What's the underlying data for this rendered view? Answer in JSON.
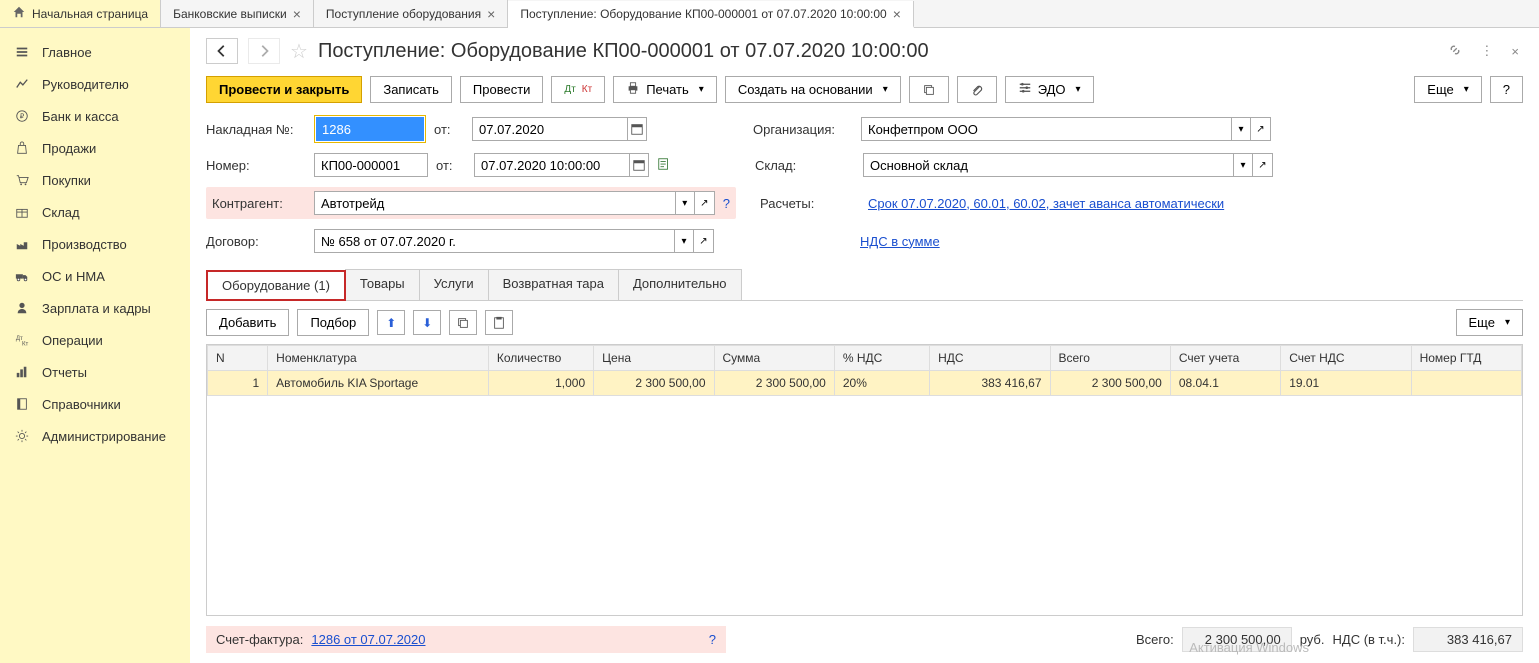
{
  "tabs": {
    "home": "Начальная страница",
    "t1": "Банковские выписки",
    "t2": "Поступление оборудования",
    "t3": "Поступление: Оборудование КП00-000001 от 07.07.2020 10:00:00"
  },
  "sidebar": [
    {
      "icon": "menu",
      "label": "Главное"
    },
    {
      "icon": "chart",
      "label": "Руководителю"
    },
    {
      "icon": "ruble",
      "label": "Банк и касса"
    },
    {
      "icon": "bag",
      "label": "Продажи"
    },
    {
      "icon": "cart",
      "label": "Покупки"
    },
    {
      "icon": "box",
      "label": "Склад"
    },
    {
      "icon": "factory",
      "label": "Производство"
    },
    {
      "icon": "truck",
      "label": "ОС и НМА"
    },
    {
      "icon": "person",
      "label": "Зарплата и кадры"
    },
    {
      "icon": "ops",
      "label": "Операции"
    },
    {
      "icon": "bars",
      "label": "Отчеты"
    },
    {
      "icon": "book",
      "label": "Справочники"
    },
    {
      "icon": "gear",
      "label": "Администрирование"
    }
  ],
  "page_title": "Поступление: Оборудование КП00-000001 от 07.07.2020 10:00:00",
  "toolbar": {
    "post_close": "Провести и закрыть",
    "save": "Записать",
    "post": "Провести",
    "print": "Печать",
    "create_based": "Создать на основании",
    "edo": "ЭДО",
    "more": "Еще"
  },
  "form": {
    "invoice_label": "Накладная  №:",
    "invoice_no": "1286",
    "from_label": "от:",
    "invoice_date": "07.07.2020",
    "number_label": "Номер:",
    "number": "КП00-000001",
    "doc_date": "07.07.2020 10:00:00",
    "org_label": "Организация:",
    "org": "Конфетпром ООО",
    "warehouse_label": "Склад:",
    "warehouse": "Основной склад",
    "counterparty_label": "Контрагент:",
    "counterparty": "Автотрейд",
    "calc_label": "Расчеты:",
    "calc_link": "Срок 07.07.2020, 60.01, 60.02, зачет аванса автоматически",
    "contract_label": "Договор:",
    "contract": "№ 658 от 07.07.2020 г.",
    "vat_link": "НДС в сумме"
  },
  "inner_tabs": [
    "Оборудование (1)",
    "Товары",
    "Услуги",
    "Возвратная тара",
    "Дополнительно"
  ],
  "tbl_toolbar": {
    "add": "Добавить",
    "pick": "Подбор",
    "more": "Еще"
  },
  "columns": [
    "N",
    "Номенклатура",
    "Количество",
    "Цена",
    "Сумма",
    "% НДС",
    "НДС",
    "Всего",
    "Счет учета",
    "Счет НДС",
    "Номер ГТД"
  ],
  "rows": [
    {
      "n": "1",
      "nom": "Автомобиль KIA Sportage",
      "qty": "1,000",
      "price": "2 300 500,00",
      "sum": "2 300 500,00",
      "vat_pct": "20%",
      "vat": "383 416,67",
      "total": "2 300 500,00",
      "acct": "08.04.1",
      "vat_acct": "19.01",
      "gtd": ""
    }
  ],
  "footer": {
    "sf_label": "Счет-фактура:",
    "sf_link": "1286 от 07.07.2020",
    "total_label": "Всего:",
    "total": "2 300 500,00",
    "currency": "руб.",
    "vat_label": "НДС (в т.ч.):",
    "vat": "383 416,67"
  },
  "watermark": "Активация Windows"
}
